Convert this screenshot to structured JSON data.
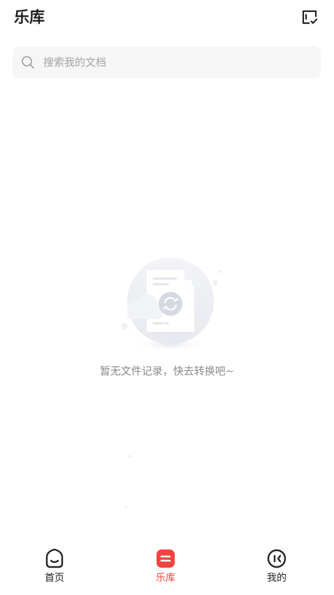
{
  "header": {
    "title": "乐库"
  },
  "search": {
    "placeholder": "搜索我的文档"
  },
  "empty_state": {
    "message": "暂无文件记录，快去转换吧~"
  },
  "bottom_nav": {
    "items": [
      {
        "label": "首页",
        "icon": "home-smile-icon",
        "active": false
      },
      {
        "label": "乐库",
        "icon": "library-icon",
        "active": true
      },
      {
        "label": "我的",
        "icon": "profile-face-icon",
        "active": false
      }
    ]
  },
  "colors": {
    "accent": "#f0443f",
    "text": "#222222",
    "muted": "#8a8a8a",
    "search_bg": "#f6f6f6"
  }
}
